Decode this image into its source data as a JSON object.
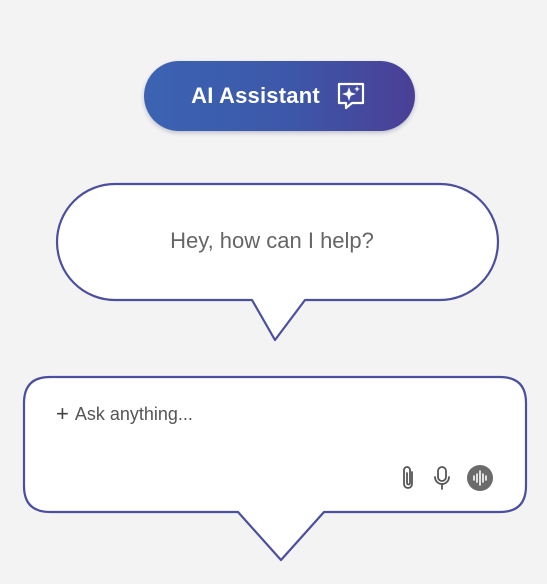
{
  "header": {
    "title": "AI Assistant",
    "icon": "sparkle-chat-icon"
  },
  "bubble": {
    "message": "Hey, how can I help?"
  },
  "composer": {
    "plus_label": "+",
    "placeholder": "Ask anything...",
    "tools": [
      "paperclip-icon",
      "microphone-icon",
      "voice-wave-icon"
    ]
  },
  "colors": {
    "background": "#f3f3f3",
    "accent_start": "#3c63b3",
    "accent_end": "#4a3f96",
    "outline": "#4b4f9e"
  }
}
